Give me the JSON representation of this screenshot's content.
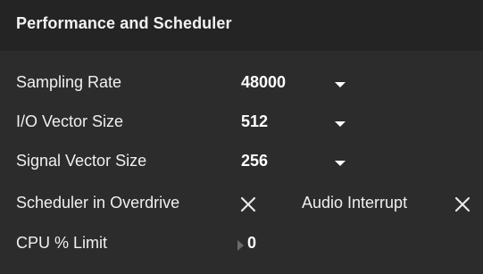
{
  "panel": {
    "title": "Performance and Scheduler"
  },
  "settings": {
    "sampling_rate": {
      "label": "Sampling Rate",
      "value": "48000"
    },
    "io_vector_size": {
      "label": "I/O Vector Size",
      "value": "512"
    },
    "signal_vector_size": {
      "label": "Signal Vector Size",
      "value": "256"
    },
    "scheduler_overdrive": {
      "label": "Scheduler in Overdrive",
      "checked": false,
      "icon": "x-icon"
    },
    "audio_interrupt": {
      "label": "Audio Interrupt",
      "checked": false,
      "icon": "x-icon"
    },
    "cpu_limit": {
      "label": "CPU % Limit",
      "value": "0",
      "icon": "triangle-right-icon"
    }
  },
  "colors": {
    "background": "#2c2c2c",
    "header_background": "#242424",
    "text": "#ffffff",
    "muted_arrow": "#6a6a6a",
    "toggle_x": "#e8e8e8"
  }
}
